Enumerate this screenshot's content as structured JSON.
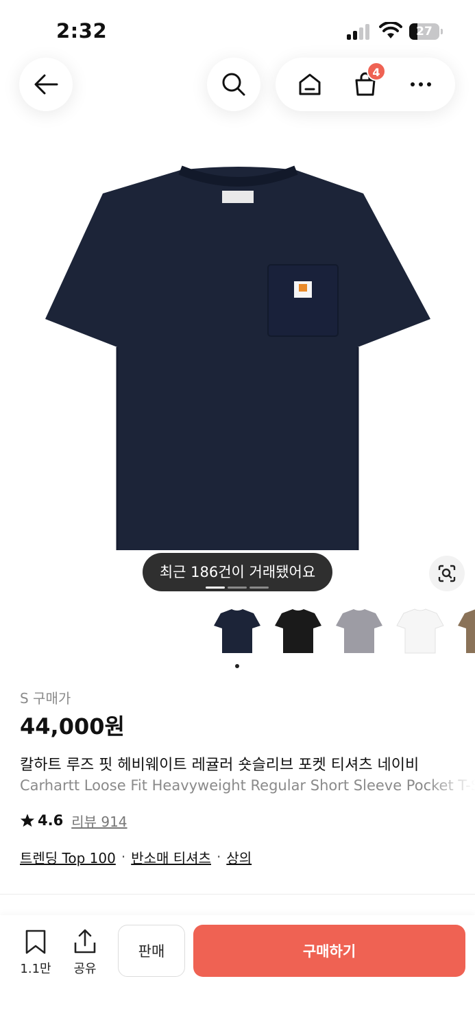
{
  "status": {
    "time": "2:32",
    "battery": "27"
  },
  "nav": {
    "cart_count": "4"
  },
  "product": {
    "trade_count_text": "최근 186건이 거래됐어요",
    "size_label": "S 구매가",
    "price": "44,000원",
    "title_ko": "칼하트 루즈 핏 헤비웨이트 레귤러 숏슬리브 포켓 티셔츠 네이비",
    "title_en": "Carhartt Loose Fit Heavyweight Regular Short Sleeve Pocket T-Shirt",
    "rating": "4.6",
    "review_label": "리뷰 914",
    "tags": [
      "트렌딩 Top 100",
      "반소매 티셔츠",
      "상의"
    ],
    "thumbnails": [
      {
        "color_name": "navy",
        "color": "#1c2438"
      },
      {
        "color_name": "black",
        "color": "#1a1a1a"
      },
      {
        "color_name": "grey",
        "color": "#9d9ca4"
      },
      {
        "color_name": "white",
        "color": "#f6f6f6"
      },
      {
        "color_name": "brown",
        "color": "#8a7258"
      }
    ]
  },
  "bottom_bar": {
    "save_count": "1.1만",
    "share_label": "공유",
    "sell_label": "판매",
    "buy_label": "구매하기"
  },
  "colors": {
    "accent": "#ef6253",
    "shirt": "#1c2438"
  }
}
